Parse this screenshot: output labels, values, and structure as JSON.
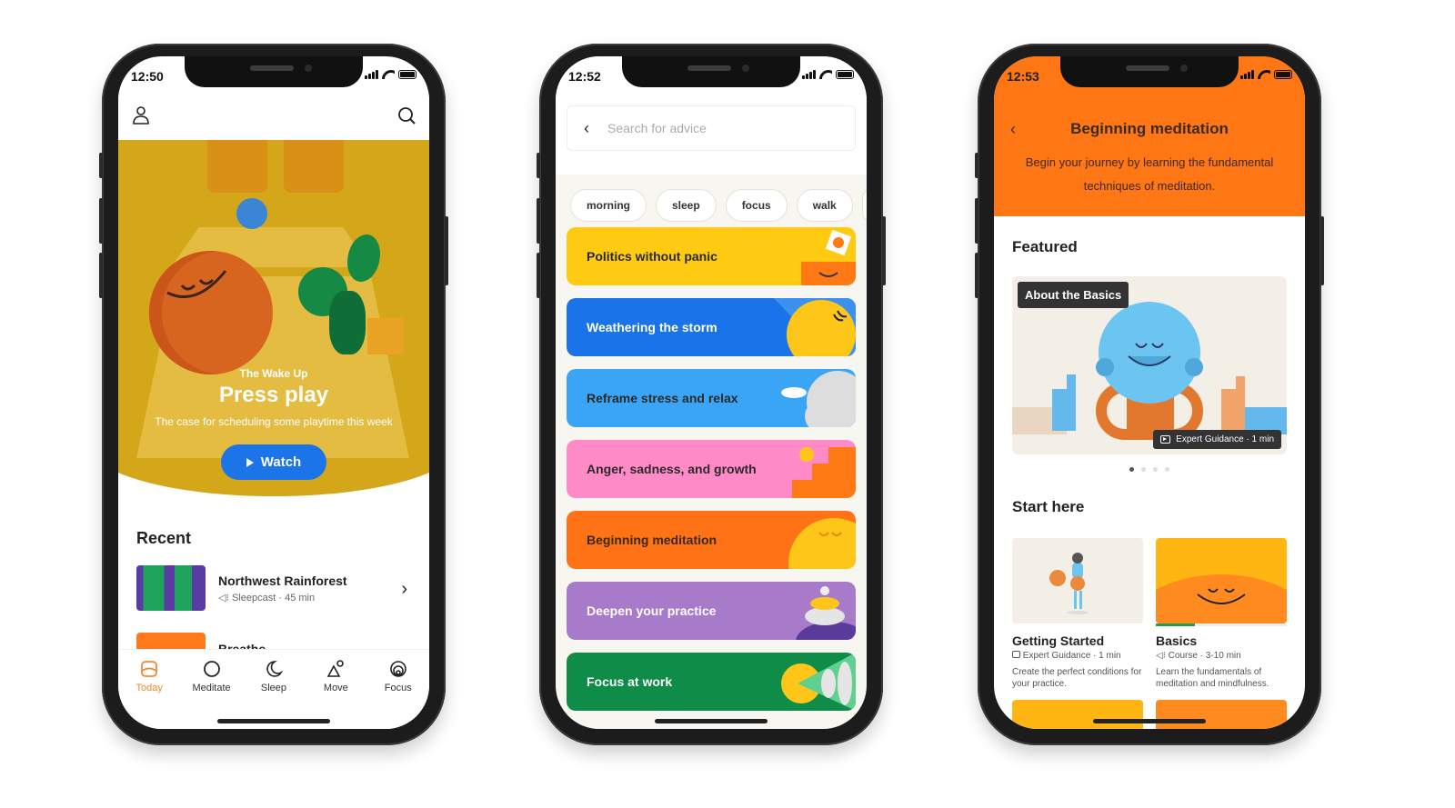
{
  "colors": {
    "hero_yellow": "#d4a61a",
    "watch_blue": "#1b74e8",
    "today_orange": "#f08a2c",
    "header_orange": "#ff7614",
    "progress_green": "#1fa34a"
  },
  "phone1": {
    "status_time": "12:50",
    "top_icons": [
      "profile-icon",
      "search-icon"
    ],
    "hero": {
      "eyebrow": "The Wake Up",
      "headline": "Press play",
      "subtitle": "The case for scheduling some playtime this week",
      "button_label": "Watch"
    },
    "recent": {
      "heading": "Recent",
      "items": [
        {
          "title": "Northwest Rainforest",
          "meta": "Sleepcast · 45 min"
        },
        {
          "title": "Breathe",
          "meta": ""
        }
      ]
    },
    "tabs": [
      {
        "label": "Today",
        "icon": "today-icon",
        "active": true
      },
      {
        "label": "Meditate",
        "icon": "meditate-icon",
        "active": false
      },
      {
        "label": "Sleep",
        "icon": "moon-icon",
        "active": false
      },
      {
        "label": "Move",
        "icon": "move-icon",
        "active": false
      },
      {
        "label": "Focus",
        "icon": "focus-icon",
        "active": false
      }
    ]
  },
  "phone2": {
    "status_time": "12:52",
    "search": {
      "placeholder": "Search for advice"
    },
    "chips": [
      "morning",
      "sleep",
      "focus",
      "walk"
    ],
    "cards": [
      {
        "label": "Politics without panic",
        "color": "#ffcb12",
        "text_color": "#2a2a2a"
      },
      {
        "label": "Weathering the storm",
        "color": "#1a73e8",
        "text_color": "#ffffff"
      },
      {
        "label": "Reframe stress and relax",
        "color": "#3aa5f5",
        "text_color": "#2a2a2a"
      },
      {
        "label": "Anger, sadness, and growth",
        "color": "#ff8ac8",
        "text_color": "#2a2a2a"
      },
      {
        "label": "Beginning meditation",
        "color": "#ff7216",
        "text_color": "#3a2a1a"
      },
      {
        "label": "Deepen your practice",
        "color": "#a77bca",
        "text_color": "#ffffff"
      },
      {
        "label": "Focus at work",
        "color": "#0e8c48",
        "text_color": "#ffffff"
      }
    ]
  },
  "phone3": {
    "status_time": "12:53",
    "header": {
      "title": "Beginning meditation",
      "description": "Begin your journey by learning the fundamental techniques of meditation."
    },
    "featured": {
      "heading": "Featured",
      "card_label": "About the Basics",
      "badge": "Expert Guidance · 1 min",
      "page_count": 4,
      "active_page": 1
    },
    "start_here": {
      "heading": "Start here",
      "items": [
        {
          "title": "Getting Started",
          "meta": "Expert Guidance · 1 min",
          "meta_icon": "video-icon",
          "description": "Create the perfect conditions for your practice.",
          "progress": 0
        },
        {
          "title": "Basics",
          "meta": "Course · 3-10 min",
          "meta_icon": "audio-icon",
          "description": "Learn the fundamentals of meditation and mindfulness.",
          "progress": 0.3
        }
      ]
    }
  }
}
